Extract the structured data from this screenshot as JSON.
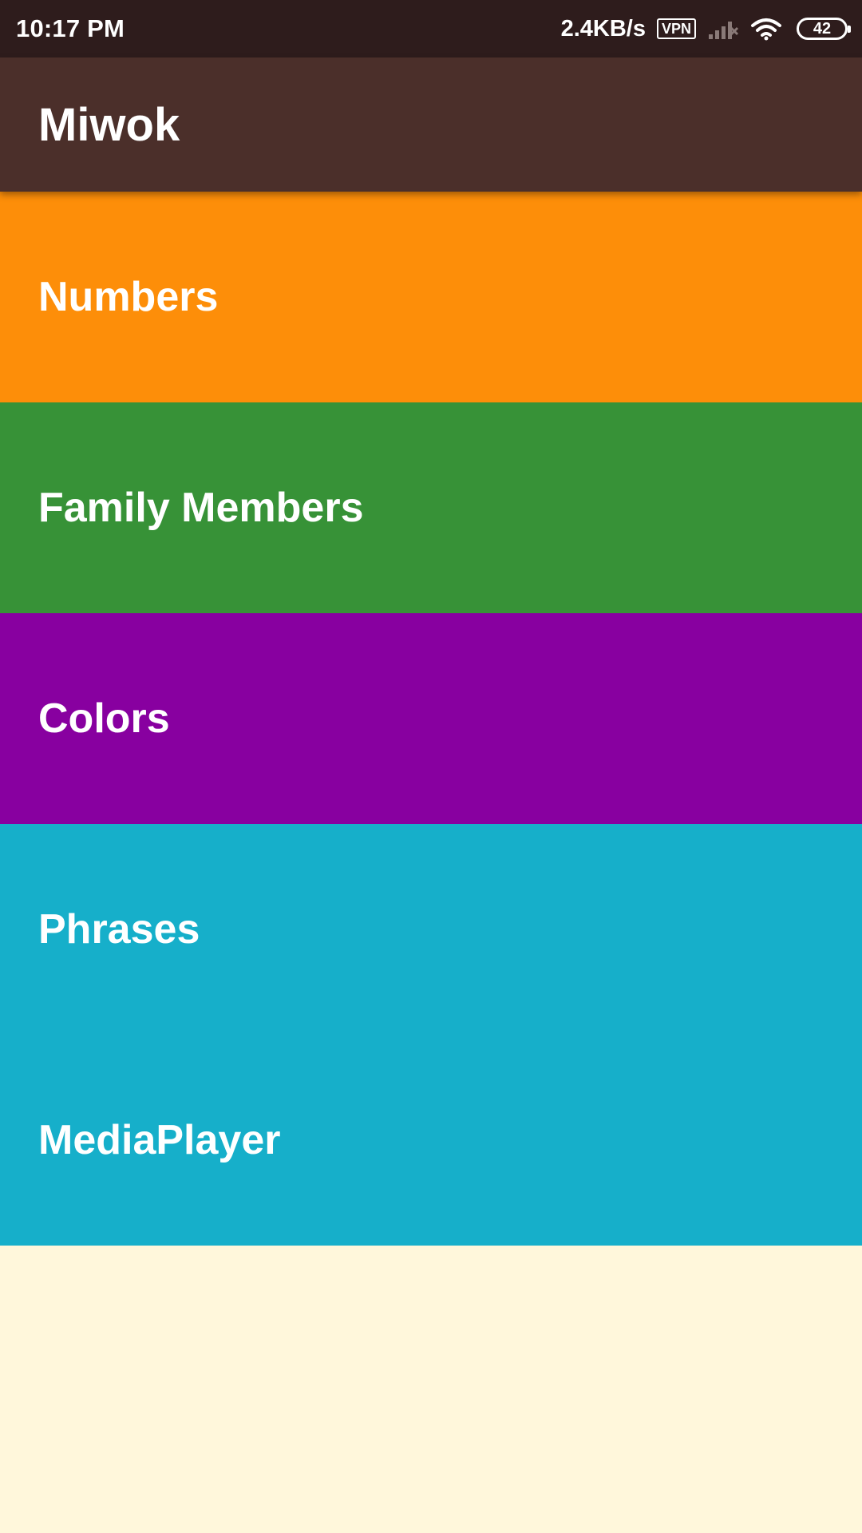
{
  "status_bar": {
    "time": "10:17 PM",
    "net_speed": "2.4KB/s",
    "vpn_label": "VPN",
    "battery_level": "42",
    "icons": [
      "signal-icon",
      "wifi-icon",
      "battery-icon"
    ]
  },
  "app_bar": {
    "title": "Miwok",
    "color": "#4B2F2A"
  },
  "categories": [
    {
      "label": "Numbers",
      "color": "#FD8E09"
    },
    {
      "label": "Family Members",
      "color": "#379237"
    },
    {
      "label": "Colors",
      "color": "#8800A0"
    },
    {
      "label": "Phrases",
      "color": "#16AFCA"
    },
    {
      "label": "MediaPlayer",
      "color": "#16AFCA"
    }
  ],
  "background_color": "#FFF7DB"
}
